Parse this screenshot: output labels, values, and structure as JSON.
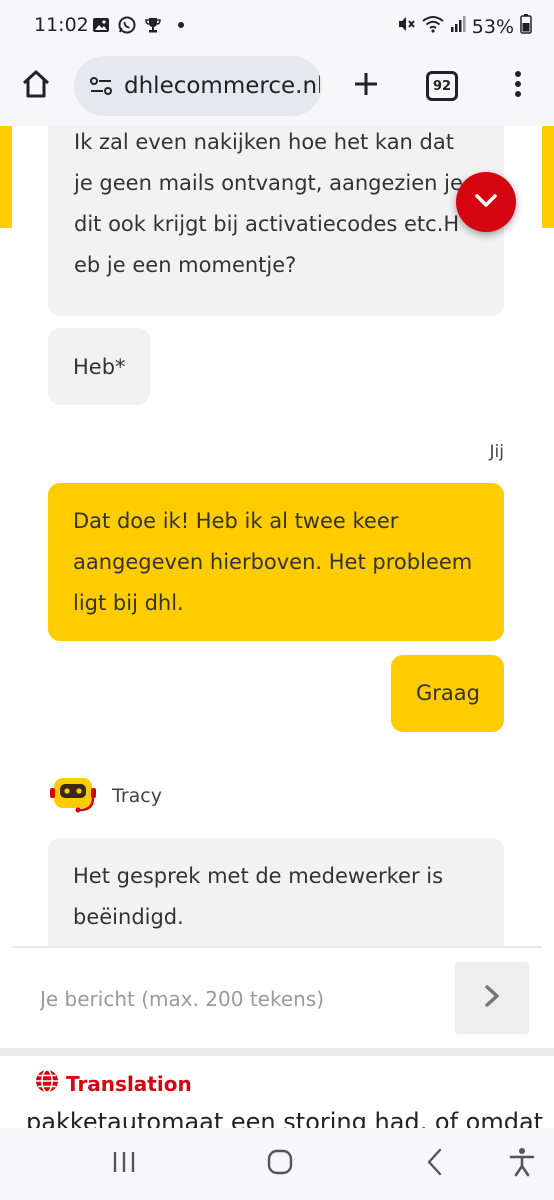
{
  "status_bar": {
    "time": "11:02",
    "battery": "53%",
    "icons": [
      "image-icon",
      "whatsapp-icon",
      "trophy-icon",
      "mute-icon",
      "wifi-icon",
      "signal-icon",
      "battery-icon"
    ]
  },
  "browser": {
    "url": "dhlecommerce.nl",
    "tab_count": "92"
  },
  "chat": {
    "messages": [
      {
        "from": "agent",
        "text": "Ik zal even nakijken hoe het kan dat je geen mails ontvangt, aangezien je dit ook krijgt bij activatiecodes etc.H eb je een momentje?"
      },
      {
        "from": "agent",
        "text": "Heb*"
      },
      {
        "from": "user",
        "text": "Dat doe ik! Heb ik al twee keer aangegeven hierboven. Het probleem ligt bij dhl."
      },
      {
        "from": "user",
        "text": "Graag"
      },
      {
        "from": "agent",
        "text": "Het gesprek met de medewerker is beëindigd."
      }
    ],
    "user_label": "Jij",
    "bot_name": "Tracy"
  },
  "composer": {
    "placeholder": "Je bericht (max. 200 tekens)"
  },
  "translation": {
    "title": "Translation",
    "text": "pakketautomaat een storing had, of omdat"
  },
  "colors": {
    "dhl_yellow": "#ffcc00",
    "dhl_red": "#d40511",
    "agent_bubble": "#f2f2f2"
  }
}
